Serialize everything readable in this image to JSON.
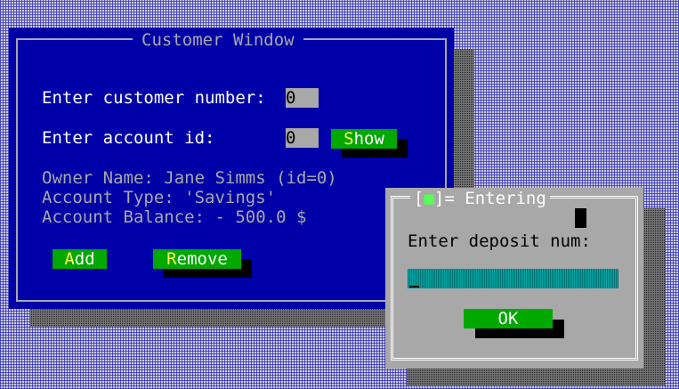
{
  "customer_window": {
    "title": "Customer Window",
    "customer_number_label": "Enter customer number:",
    "customer_number_value": "0",
    "account_id_label": "Enter account id:",
    "account_id_value": "0",
    "show_button": {
      "hotkey": "S",
      "rest": "how"
    },
    "owner_line": "Owner Name: Jane Simms (id=0)",
    "type_line": "Account Type: 'Savings'",
    "balance_line": "Account Balance: - 500.0 $",
    "add_button": {
      "hotkey": "A",
      "rest": "dd"
    },
    "remove_button": {
      "hotkey": "R",
      "rest": "emove"
    }
  },
  "dialog": {
    "close_open": "[",
    "close_glyph": "■",
    "close_close": "]",
    "title": "Entering",
    "prompt": "Enter deposit num:",
    "input_value": "",
    "ok_label": "OK"
  },
  "colors": {
    "desktop": "#c8c8e0",
    "window_bg": "#0000a8",
    "frame": "#a8a8a8",
    "button_bg": "#00a800",
    "hotkey": "#ffff55",
    "input_bg": "#00a8a8"
  }
}
